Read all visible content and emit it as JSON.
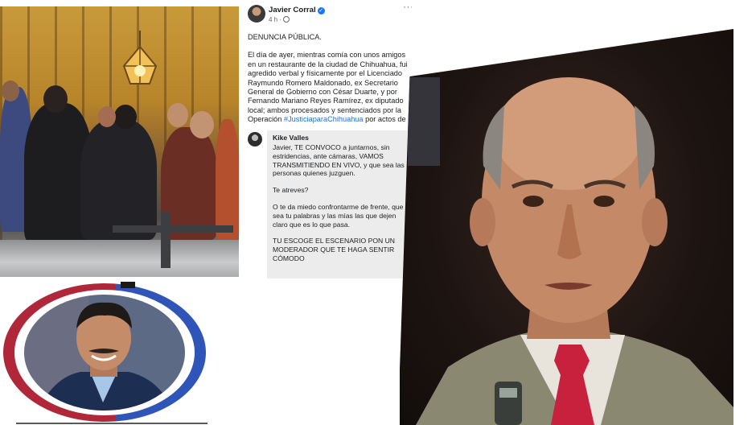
{
  "post": {
    "author": "Javier Corral",
    "meta": "4 h ·",
    "more_label": "···",
    "verified_glyph": "✓",
    "heading": "DENUNCIA PÚBLICA.",
    "body_before_hashtag": "El día de ayer, mientras comía con unos amigos en un restaurante de la ciudad de Chihuahua, fui agredido verbal y físicamente por el Licenciado Raymundo Romero Maldonado, ex Secretario General de Gobierno con César Duarte, y por Fernando Mariano Reyes Ramírez, ex diputado local; ambos procesados y sentenciados por la Operación",
    "hashtag": "#JusticiaparaChihuahua",
    "body_after_hashtag": " por actos de"
  },
  "quote": {
    "author": "Kike Valles",
    "paragraph_1": "Javier, TE CONVOCO a juntarnos, sin estridencias, ante cámaras, VAMOS TRANSMITIENDO EN VIVO, y que sea las personas quienes juzguen.",
    "paragraph_2": "Te atreves?",
    "paragraph_3": "O te da miedo confrontarme de frente, que sea tu palabras y las mías las que dejen claro que es lo que pasa.",
    "paragraph_4": "TU ESCOGE EL ESCENARIO PON UN MODERADOR QUE TE HAGA SENTIR CÓMODO"
  },
  "colors": {
    "hashtag": "#216fdb",
    "verified": "#1877f2",
    "badge_ring_red": "#b0273a",
    "badge_ring_blue": "#2f55b8",
    "tie": "#c8213e"
  },
  "icons": {
    "verified": "verified-check-icon",
    "privacy": "globe-icon",
    "more": "more-options-icon"
  }
}
